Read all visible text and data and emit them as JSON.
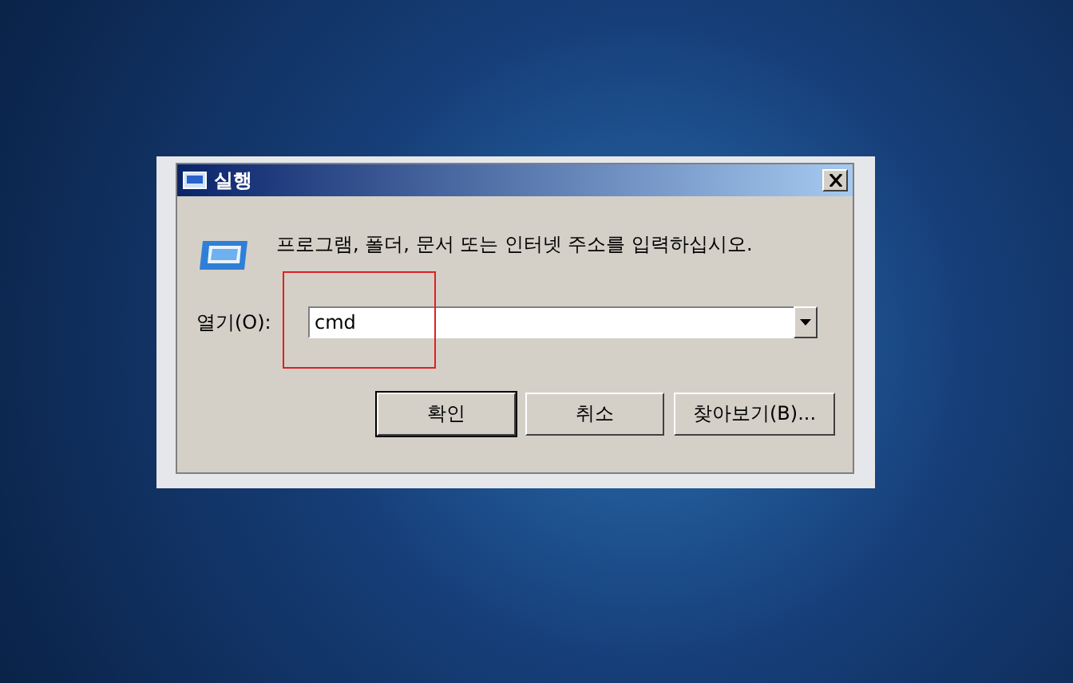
{
  "window": {
    "title": "실행"
  },
  "message": "프로그램, 폴더, 문서 또는 인터넷 주소를 입력하십시오.",
  "open_field": {
    "label": "열기(O):",
    "value": "cmd"
  },
  "buttons": [
    {
      "label": "확인",
      "default": true
    },
    {
      "label": "취소",
      "default": false
    },
    {
      "label": "찾아보기(B)...",
      "default": false
    }
  ]
}
